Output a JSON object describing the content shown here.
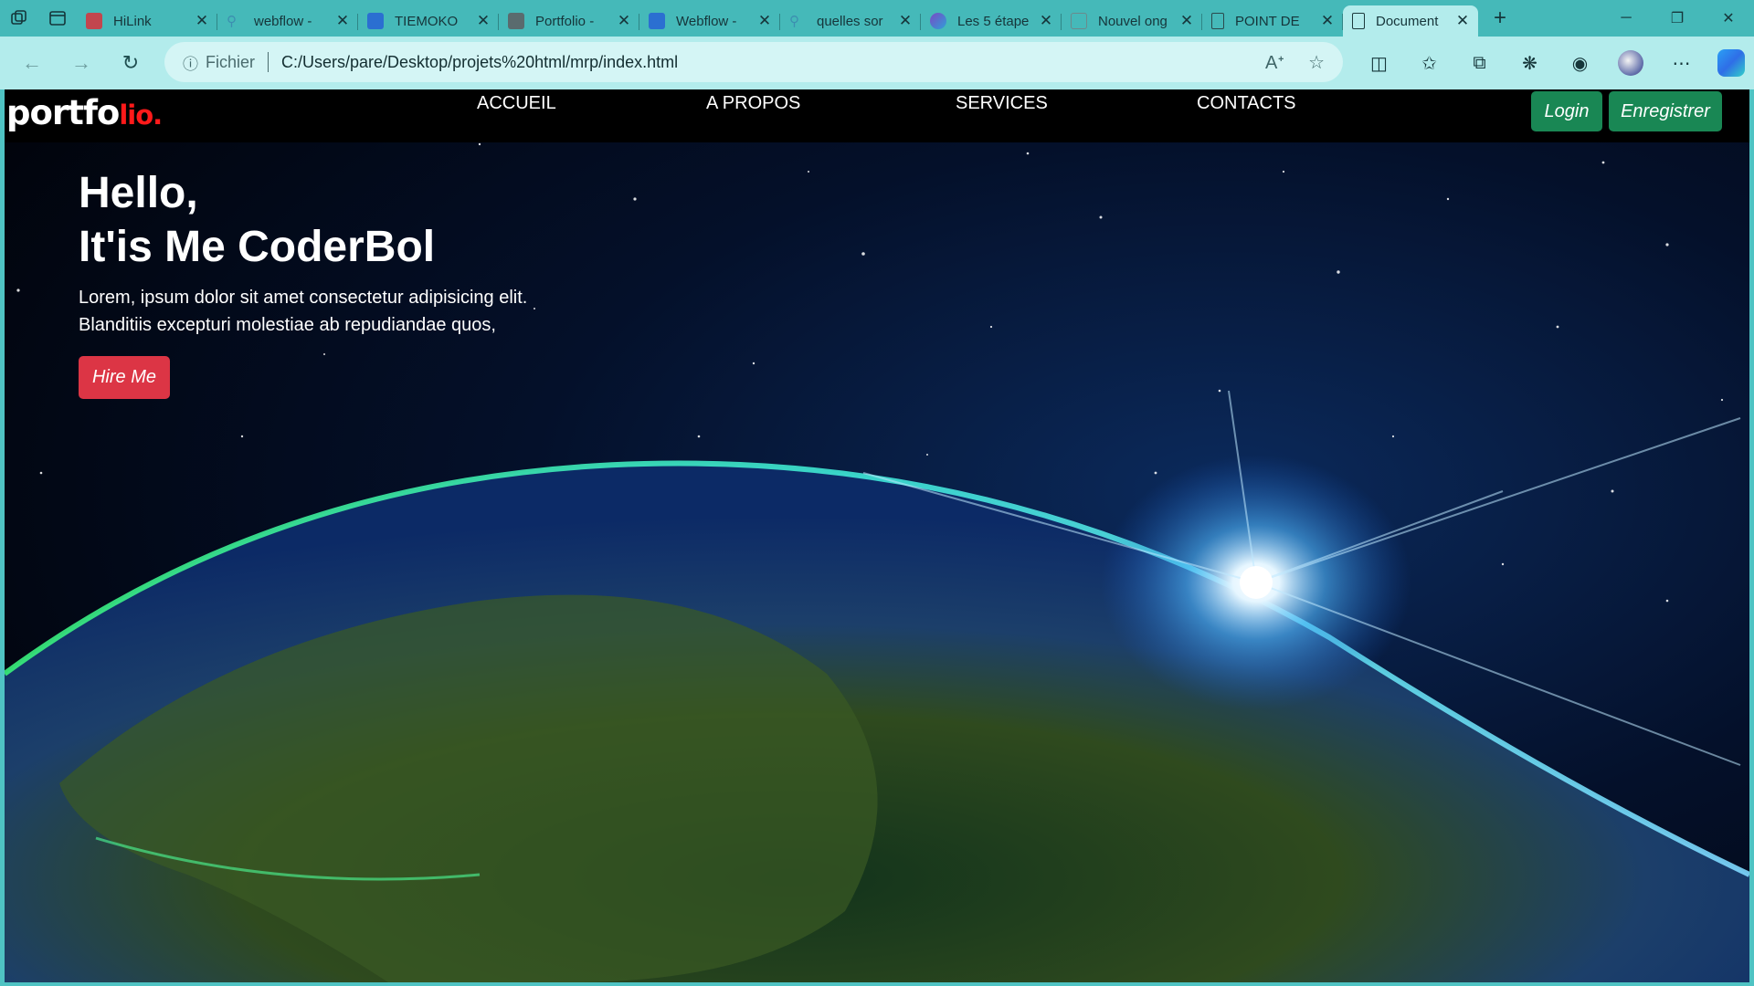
{
  "browser": {
    "tabs": [
      {
        "title": "HiLink",
        "favicon_color": "#c2464e"
      },
      {
        "title": "webflow - ",
        "favicon_color": "#3c8fb0"
      },
      {
        "title": "TIEMOKO ",
        "favicon_color": "#2b6fd1"
      },
      {
        "title": "Portfolio - ",
        "favicon_color": "#5a6b6e"
      },
      {
        "title": "Webflow - ",
        "favicon_color": "#2b6fd1"
      },
      {
        "title": "quelles sor",
        "favicon_color": "#3c8fb0"
      },
      {
        "title": "Les 5 étape",
        "favicon_color": "#7a4ac4"
      },
      {
        "title": "Nouvel ong",
        "favicon_color": "#6b8a8c"
      },
      {
        "title": "POINT DE ",
        "favicon_color": "#6b8a8c"
      },
      {
        "title": "Document",
        "favicon_color": "#1d3a3d",
        "active": true
      }
    ],
    "address": {
      "scheme_label": "Fichier",
      "url": "C:/Users/pare/Desktop/projets%20html/mrp/index.html"
    },
    "colors": {
      "frame": "#45b9b9",
      "toolbar": "#b3ecec"
    }
  },
  "site": {
    "brand": {
      "main": "portfo",
      "accent": "lio."
    },
    "nav": [
      "ACCUEIL",
      "A PROPOS",
      "SERVICES",
      "CONTACTS"
    ],
    "login_label": "Login",
    "register_label": "Enregistrer",
    "hero": {
      "title_line1": "Hello,",
      "title_line2": "It'is Me CoderBol",
      "text_line1": "Lorem, ipsum dolor sit amet consectetur adipisicing elit.",
      "text_line2": "Blanditiis excepturi molestiae ab repudiandae quos,",
      "cta_label": "Hire Me"
    },
    "colors": {
      "brand_accent": "#ff1a1a",
      "button_green": "#198754",
      "button_red": "#dc3545"
    }
  }
}
